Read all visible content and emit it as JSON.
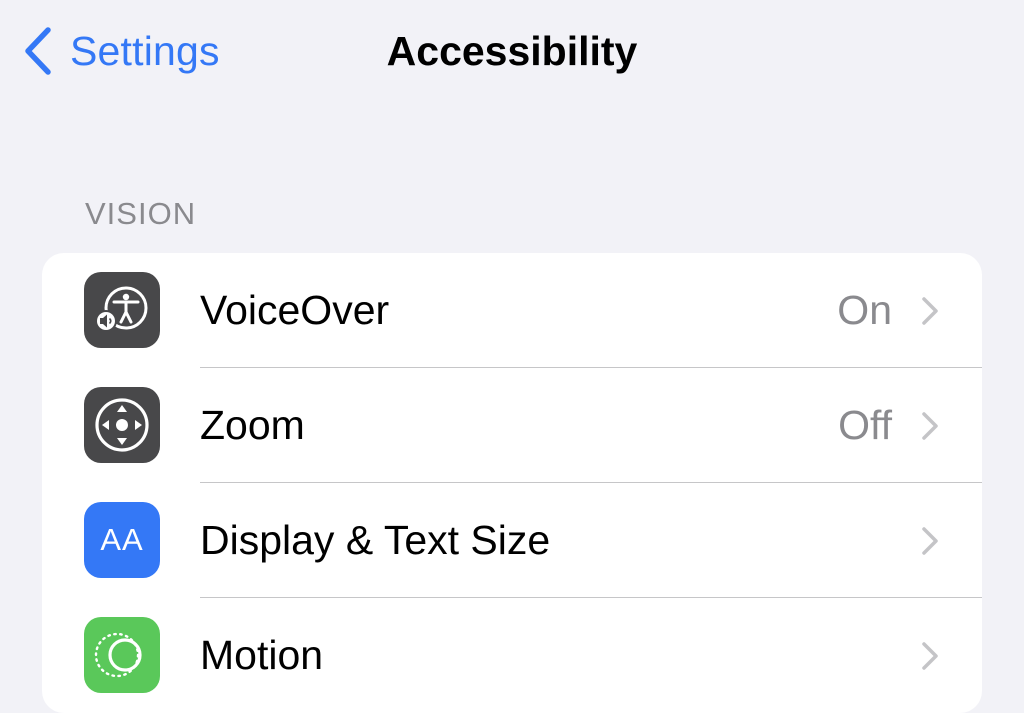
{
  "nav": {
    "back_label": "Settings",
    "title": "Accessibility"
  },
  "section": {
    "header": "VISION"
  },
  "rows": [
    {
      "label": "VoiceOver",
      "value": "On",
      "icon": "voiceover-icon",
      "icon_bg": "#48484a"
    },
    {
      "label": "Zoom",
      "value": "Off",
      "icon": "zoom-icon",
      "icon_bg": "#48484a"
    },
    {
      "label": "Display & Text Size",
      "value": "",
      "icon": "display-text-size-icon",
      "icon_bg": "#3478f6",
      "icon_text": "AA"
    },
    {
      "label": "Motion",
      "value": "",
      "icon": "motion-icon",
      "icon_bg": "#5ac85a"
    }
  ],
  "colors": {
    "accent": "#3478f6",
    "background": "#f2f2f7",
    "secondary_text": "#8a8a8e"
  }
}
